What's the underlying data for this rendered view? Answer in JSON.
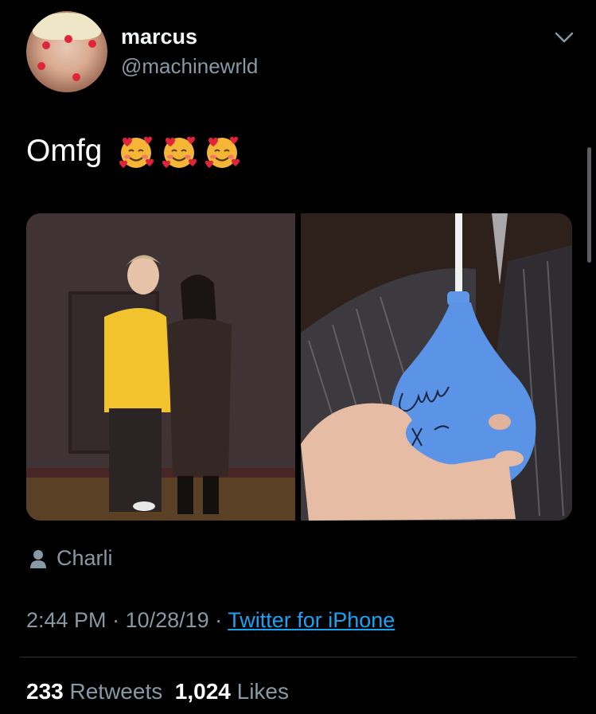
{
  "author": {
    "name": "marcus",
    "handle": "@machinewrld"
  },
  "tweet": {
    "text": "Omfg",
    "emojis": [
      "smiling-face-with-hearts",
      "smiling-face-with-hearts",
      "smiling-face-with-hearts"
    ],
    "location": "Charli"
  },
  "meta": {
    "time": "2:44 PM",
    "separator1": " · ",
    "date": "10/28/19",
    "separator2": " · ",
    "source": "Twitter for iPhone"
  },
  "stats": {
    "retweets_count": "233",
    "retweets_label": "Retweets",
    "likes_count": "1,024",
    "likes_label": "Likes"
  },
  "colors": {
    "background": "#000000",
    "secondary_text": "#8899a6",
    "link": "#1da1f2"
  }
}
